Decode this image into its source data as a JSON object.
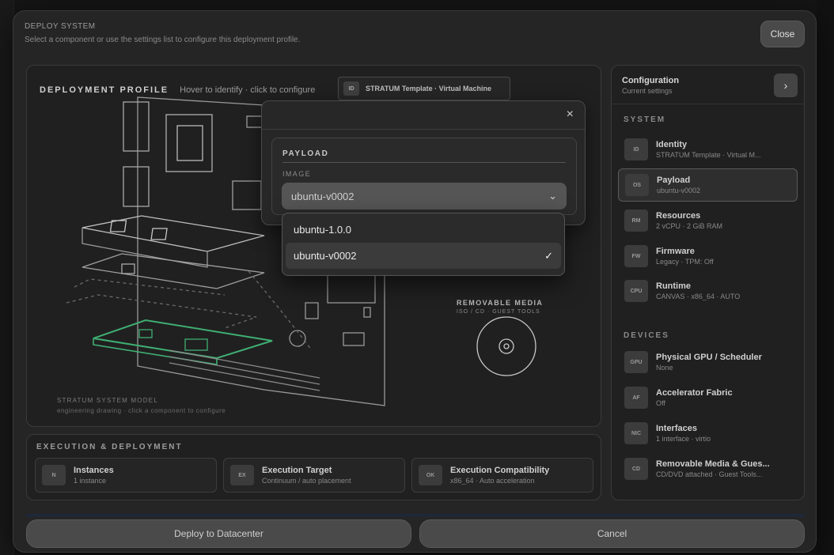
{
  "dialog": {
    "title": "DEPLOY SYSTEM",
    "subtitle": "Select a component or use the settings list to configure this deployment profile.",
    "close_label": "Close"
  },
  "profile": {
    "title": "DEPLOYMENT PROFILE",
    "hint": "Hover to identify · click to configure",
    "template_badge": "ID",
    "template_label": "STRATUM Template · Virtual Machine",
    "model_caption": "STRATUM SYSTEM MODEL",
    "model_sub": "engineering drawing · click a component to configure",
    "media_caption": "REMOVABLE MEDIA",
    "media_sub": "ISO / CD · GUEST TOOLS"
  },
  "execution": {
    "title": "EXECUTION & DEPLOYMENT",
    "cards": [
      {
        "badge": "N",
        "title": "Instances",
        "sub": "1 instance"
      },
      {
        "badge": "EX",
        "title": "Execution Target",
        "sub": "Continuum / auto placement"
      },
      {
        "badge": "OK",
        "title": "Execution Compatibility",
        "sub": "x86_64 · Auto acceleration"
      }
    ]
  },
  "config": {
    "title": "Configuration",
    "subtitle": "Current settings",
    "chevron": "›",
    "system_label": "SYSTEM",
    "devices_label": "DEVICES",
    "system_items": [
      {
        "badge": "ID",
        "title": "Identity",
        "sub": "STRATUM Template · Virtual M..."
      },
      {
        "badge": "OS",
        "title": "Payload",
        "sub": "ubuntu-v0002"
      },
      {
        "badge": "RM",
        "title": "Resources",
        "sub": "2 vCPU · 2 GiB RAM"
      },
      {
        "badge": "FW",
        "title": "Firmware",
        "sub": "Legacy · TPM: Off"
      },
      {
        "badge": "CPU",
        "title": "Runtime",
        "sub": "CANVAS · x86_64 · AUTO"
      }
    ],
    "device_items": [
      {
        "badge": "GPU",
        "title": "Physical GPU / Scheduler",
        "sub": "None"
      },
      {
        "badge": "AF",
        "title": "Accelerator Fabric",
        "sub": "Off"
      },
      {
        "badge": "NIC",
        "title": "Interfaces",
        "sub": "1 interface · virtio"
      },
      {
        "badge": "CD",
        "title": "Removable Media & Gues...",
        "sub": "CD/DVD attached · Guest Tools..."
      }
    ]
  },
  "payload": {
    "close": "×",
    "title": "PAYLOAD",
    "image_label": "IMAGE",
    "selected": "ubuntu-v0002",
    "chevron": "⌄",
    "options": [
      {
        "label": "ubuntu-1.0.0",
        "check": ""
      },
      {
        "label": "ubuntu-v0002",
        "check": "✓"
      }
    ]
  },
  "actions": {
    "deploy": "Deploy to Datacenter",
    "cancel": "Cancel"
  },
  "colors": {
    "highlight": "#3fae72",
    "panel": "#202020",
    "dialog": "#252525"
  }
}
